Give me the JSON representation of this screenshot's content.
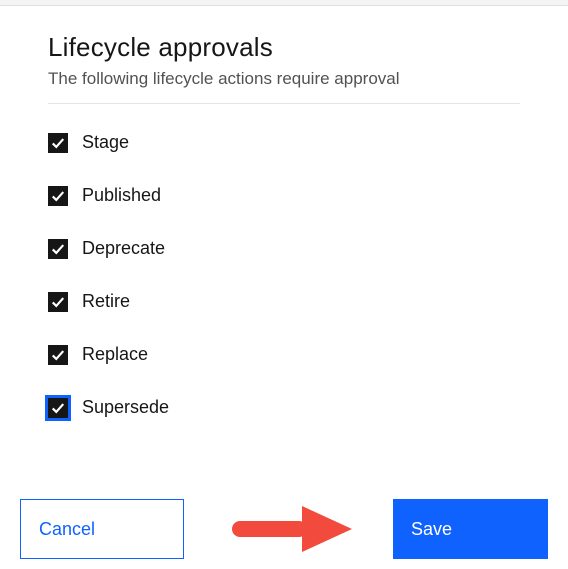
{
  "header": {
    "title": "Lifecycle approvals",
    "subtitle": "The following lifecycle actions require approval"
  },
  "options": [
    {
      "label": "Stage",
      "checked": true,
      "focused": false
    },
    {
      "label": "Published",
      "checked": true,
      "focused": false
    },
    {
      "label": "Deprecate",
      "checked": true,
      "focused": false
    },
    {
      "label": "Retire",
      "checked": true,
      "focused": false
    },
    {
      "label": "Replace",
      "checked": true,
      "focused": false
    },
    {
      "label": "Supersede",
      "checked": true,
      "focused": true
    }
  ],
  "buttons": {
    "cancel": "Cancel",
    "save": "Save"
  },
  "annotation": {
    "arrow_color": "#f24a3d"
  }
}
